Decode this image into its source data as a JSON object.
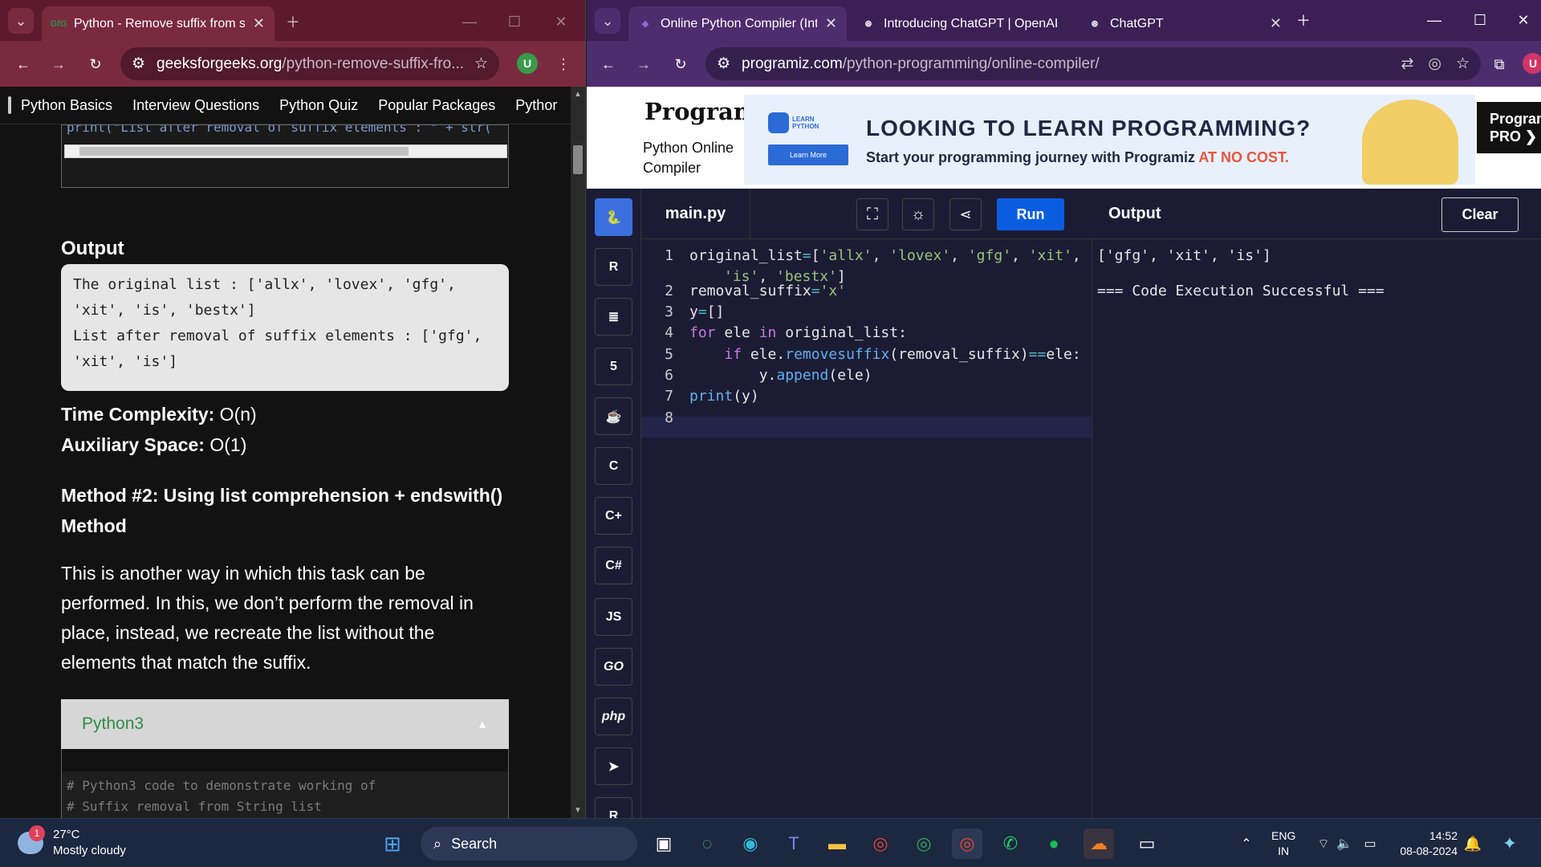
{
  "left_window": {
    "tab": {
      "title": "Python - Remove suffix from str",
      "favicon": "GfG"
    },
    "url": {
      "site": "geeksforgeeks.org",
      "path": "/python-remove-suffix-fro..."
    },
    "avatar": "U",
    "nav": [
      "Python Basics",
      "Interview Questions",
      "Python Quiz",
      "Popular Packages",
      "Pythor"
    ],
    "code_line_top": "print(\"List after removal of suffix elements : \" + str(",
    "output_heading": "Output",
    "output_lines": [
      "The original list : ['allx', 'lovex', 'gfg',",
      "'xit', 'is', 'bestx']",
      "List after removal of suffix elements : ['gfg',",
      "'xit', 'is']"
    ],
    "time_label": "Time Complexity:",
    "time_value": " O(n)",
    "space_label": "Auxiliary Space:",
    "space_value": " O(1)",
    "method_heading_1": "Method #2: Using list comprehension + endswith()",
    "method_heading_2": "Method",
    "para": [
      "This is another way in which this task can be",
      "performed. In this, we don’t perform the removal in",
      "place, instead, we recreate the list without the",
      "elements that match the suffix."
    ],
    "code_lang": "Python3",
    "comment_1": "# Python3 code to demonstrate working of",
    "comment_2": "# Suffix removal from String list"
  },
  "right_window": {
    "tabs": [
      {
        "title": "Online Python Compiler (Inter"
      },
      {
        "title": "Introducing ChatGPT | OpenAI"
      },
      {
        "title": "ChatGPT"
      }
    ],
    "url": {
      "site": "programiz.com",
      "path": "/python-programming/online-compiler/"
    },
    "avatar": "U",
    "logo": "Programiz",
    "subtitle_1": "Python Online",
    "subtitle_2": "Compiler",
    "ad": {
      "badge": "LEARN PYTHON",
      "button": "Learn More",
      "headline": "LOOKING TO LEARN PROGRAMMING?",
      "sub": "Start your programming journey with Programiz ",
      "sub_highlight": "AT NO COST."
    },
    "pro_1": "Program",
    "pro_2": "PRO ❯",
    "filename": "main.py",
    "run_label": "Run",
    "output_label": "Output",
    "clear_label": "Clear",
    "langs": [
      "py-icon",
      "r-icon",
      "sql-icon",
      "html-icon",
      "java-icon",
      "c-icon",
      "cpp-icon",
      "csharp-icon",
      "JS",
      "GO",
      "php",
      "swift-icon",
      "rust-icon"
    ],
    "line_numbers": [
      "1",
      "",
      "2",
      "3",
      "4",
      "5",
      "6",
      "7",
      "8"
    ],
    "output_lines": [
      "['gfg', 'xit', 'is']",
      "",
      "=== Code Execution Successful ==="
    ]
  },
  "taskbar": {
    "weather_temp": "27°C",
    "weather_desc": "Mostly cloudy",
    "weather_badge": "1",
    "search": "Search",
    "lang_1": "ENG",
    "lang_2": "IN",
    "time": "14:52",
    "date": "08-08-2024"
  }
}
